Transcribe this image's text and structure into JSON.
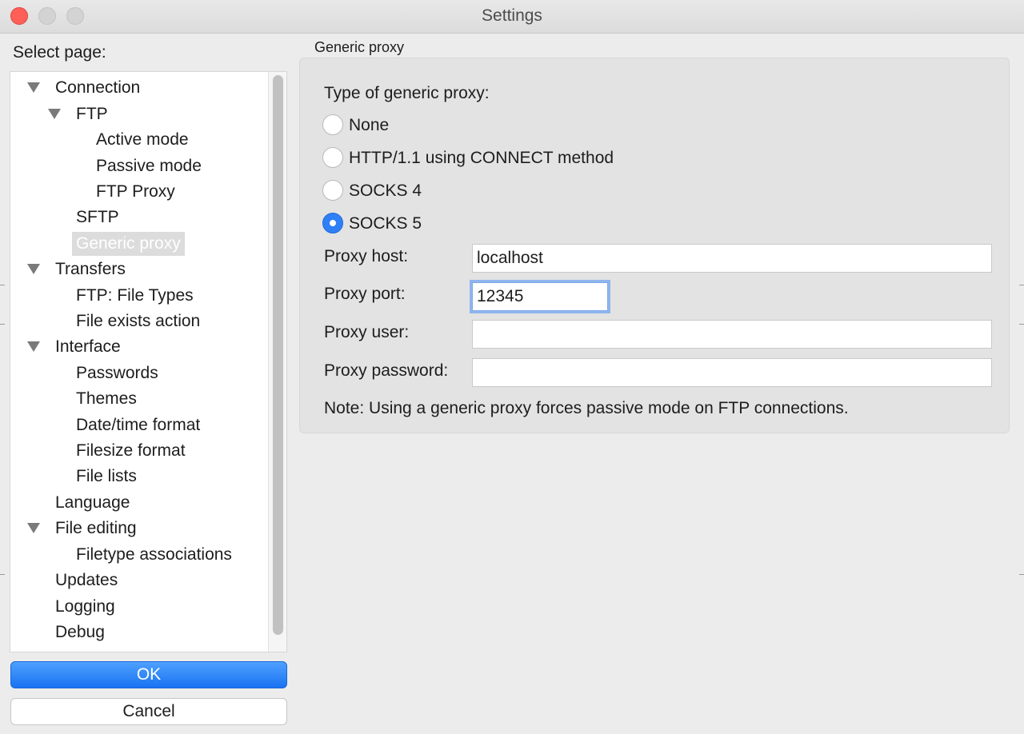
{
  "window": {
    "title": "Settings"
  },
  "sidebar": {
    "label": "Select page:",
    "items": [
      {
        "label": "Connection",
        "level": 0,
        "expandable": true
      },
      {
        "label": "FTP",
        "level": 1,
        "expandable": true
      },
      {
        "label": "Active mode",
        "level": 2,
        "expandable": false
      },
      {
        "label": "Passive mode",
        "level": 2,
        "expandable": false
      },
      {
        "label": "FTP Proxy",
        "level": 2,
        "expandable": false
      },
      {
        "label": "SFTP",
        "level": 1,
        "expandable": false
      },
      {
        "label": "Generic proxy",
        "level": 1,
        "expandable": false,
        "selected": true
      },
      {
        "label": "Transfers",
        "level": 0,
        "expandable": true
      },
      {
        "label": "FTP: File Types",
        "level": 1,
        "expandable": false
      },
      {
        "label": "File exists action",
        "level": 1,
        "expandable": false
      },
      {
        "label": "Interface",
        "level": 0,
        "expandable": true
      },
      {
        "label": "Passwords",
        "level": 1,
        "expandable": false
      },
      {
        "label": "Themes",
        "level": 1,
        "expandable": false
      },
      {
        "label": "Date/time format",
        "level": 1,
        "expandable": false
      },
      {
        "label": "Filesize format",
        "level": 1,
        "expandable": false
      },
      {
        "label": "File lists",
        "level": 1,
        "expandable": false
      },
      {
        "label": "Language",
        "level": 0,
        "expandable": false
      },
      {
        "label": "File editing",
        "level": 0,
        "expandable": true
      },
      {
        "label": "Filetype associations",
        "level": 1,
        "expandable": false
      },
      {
        "label": "Updates",
        "level": 0,
        "expandable": false
      },
      {
        "label": "Logging",
        "level": 0,
        "expandable": false
      },
      {
        "label": "Debug",
        "level": 0,
        "expandable": false
      }
    ]
  },
  "buttons": {
    "ok_label": "OK",
    "cancel_label": "Cancel"
  },
  "proxy": {
    "group_title": "Generic proxy",
    "type_label": "Type of generic proxy:",
    "options": [
      {
        "label": "None",
        "checked": false
      },
      {
        "label": "HTTP/1.1 using CONNECT method",
        "checked": false
      },
      {
        "label": "SOCKS 4",
        "checked": false
      },
      {
        "label": "SOCKS 5",
        "checked": true
      }
    ],
    "host_label": "Proxy host:",
    "host_value": "localhost",
    "port_label": "Proxy port:",
    "port_value": "12345",
    "user_label": "Proxy user:",
    "user_value": "",
    "password_label": "Proxy password:",
    "password_value": "",
    "note": "Note: Using a generic proxy forces passive mode on FTP connections."
  },
  "colors": {
    "accent": "#2f7ff6",
    "close": "#fe5f57"
  }
}
